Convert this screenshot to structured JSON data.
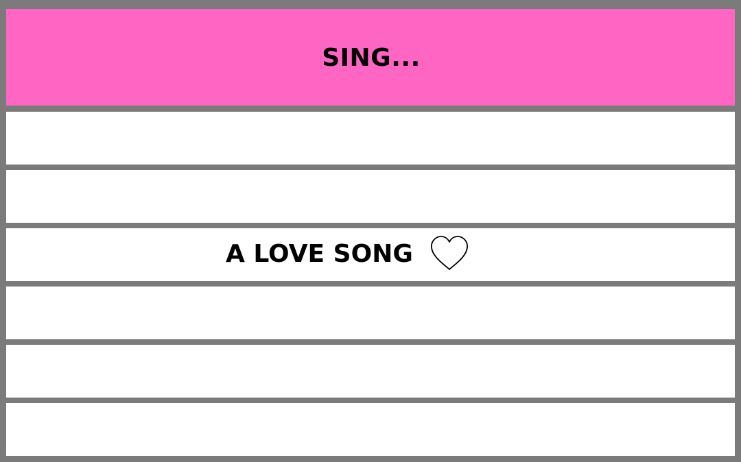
{
  "header": {
    "title": "SING...",
    "background_color": "#ff66c4"
  },
  "rows": [
    {
      "label": ""
    },
    {
      "label": ""
    },
    {
      "label": "A LOVE SONG",
      "icon": "heart-icon"
    },
    {
      "label": ""
    },
    {
      "label": ""
    },
    {
      "label": ""
    }
  ],
  "colors": {
    "grid_lines": "#7b7b7b",
    "row_background": "#ffffff",
    "text": "#000000"
  }
}
